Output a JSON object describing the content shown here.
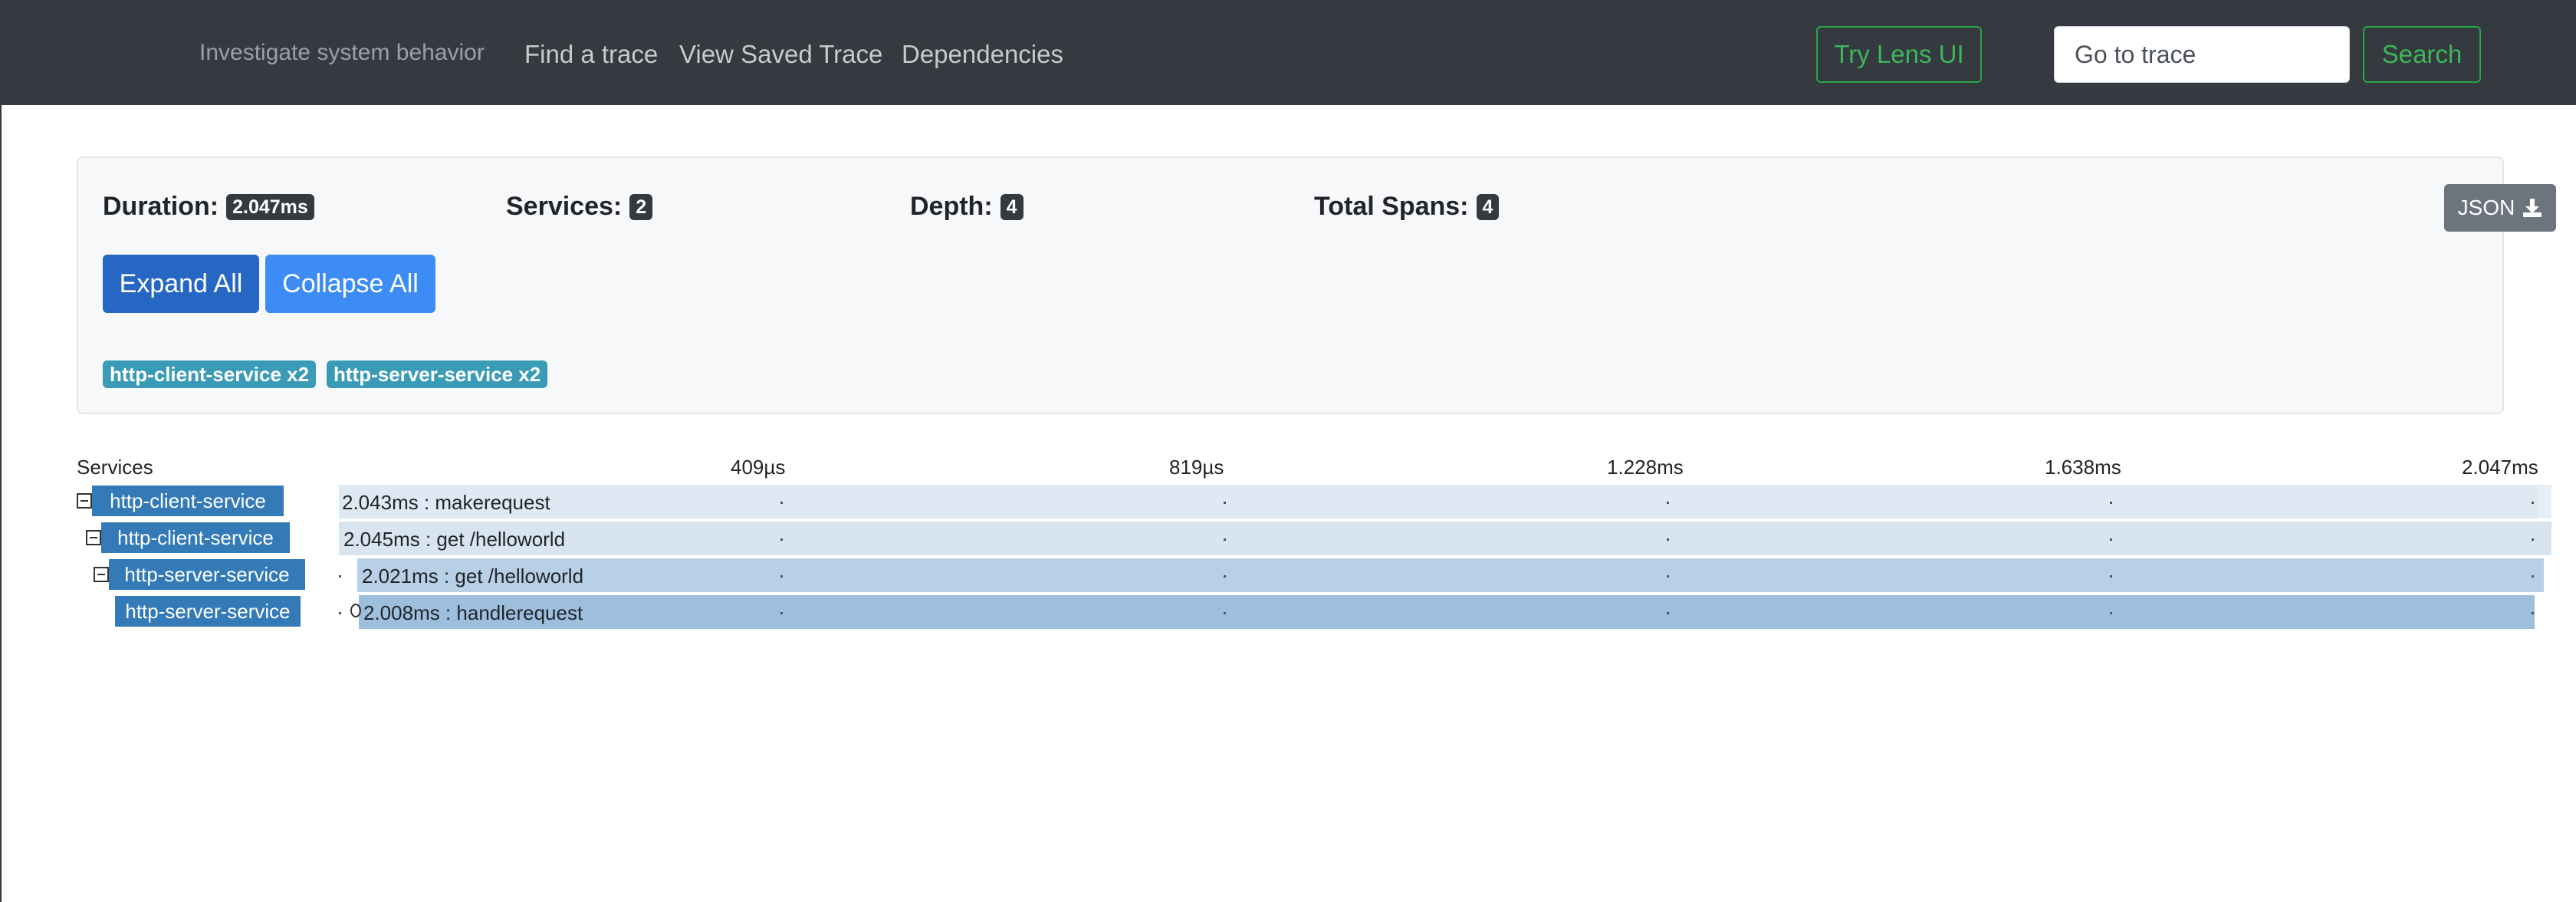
{
  "nav": {
    "brand": "Investigate system behavior",
    "links": [
      "Find a trace",
      "View Saved Trace",
      "Dependencies"
    ],
    "try_lens": "Try Lens UI",
    "goto_placeholder": "Go to trace",
    "search": "Search"
  },
  "summary": {
    "duration_label": "Duration:",
    "duration_value": "2.047ms",
    "services_label": "Services:",
    "services_value": "2",
    "depth_label": "Depth:",
    "depth_value": "4",
    "total_spans_label": "Total Spans:",
    "total_spans_value": "4",
    "json_label": "JSON",
    "expand_all": "Expand All",
    "collapse_all": "Collapse All",
    "service_badges": [
      "http-client-service x2",
      "http-server-service x2"
    ]
  },
  "timeline": {
    "services_header": "Services",
    "ticks": [
      "409µs",
      "819µs",
      "1.228ms",
      "1.638ms",
      "2.047ms"
    ],
    "spans": [
      {
        "service": "http-client-service",
        "label": "2.043ms : makerequest"
      },
      {
        "service": "http-client-service",
        "label": "2.045ms : get /helloworld"
      },
      {
        "service": "http-server-service",
        "label": "2.021ms : get /helloworld"
      },
      {
        "service": "http-server-service",
        "label": "2.008ms : handlerequest"
      }
    ]
  },
  "colors": {
    "navbar": "#343a40",
    "success": "#28a745",
    "primary": "#337ab7",
    "info": "#3a9bb7"
  }
}
